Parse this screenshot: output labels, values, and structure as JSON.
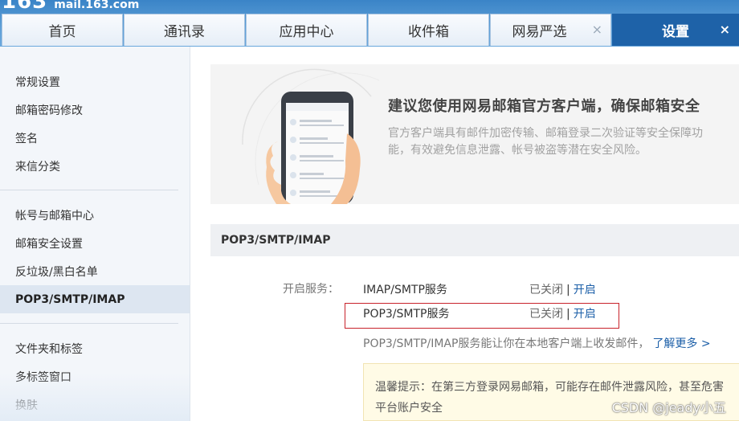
{
  "header": {
    "logo_number": "163",
    "logo_domain": "mail.163.com",
    "tabs": [
      {
        "label": "首页"
      },
      {
        "label": "通讯录"
      },
      {
        "label": "应用中心"
      },
      {
        "label": "收件箱"
      },
      {
        "label": "网易严选",
        "closable": true
      },
      {
        "label": "设置",
        "closable": true,
        "active": true
      }
    ],
    "close_glyph": "×"
  },
  "sidebar": {
    "groups": [
      {
        "items": [
          "常规设置",
          "邮箱密码修改",
          "签名",
          "来信分类"
        ]
      },
      {
        "items": [
          "帐号与邮箱中心",
          "邮箱安全设置",
          "反垃圾/黑白名单",
          "POP3/SMTP/IMAP"
        ]
      },
      {
        "items": [
          "文件夹和标签",
          "多标签窗口",
          "换肤"
        ]
      }
    ],
    "active_item": "POP3/SMTP/IMAP"
  },
  "banner": {
    "title": "建议您使用网易邮箱官方客户端，确保邮箱安全",
    "desc": "官方客户端具有邮件加密传输、邮箱登录二次验证等安全保障功能，有效避免信息泄露、帐号被盗等潜在安全风险。"
  },
  "section": {
    "title": "POP3/SMTP/IMAP",
    "service_label": "开启服务：",
    "services": [
      {
        "name": "IMAP/SMTP服务",
        "status": "已关闭",
        "action": "开启"
      },
      {
        "name": "POP3/SMTP服务",
        "status": "已关闭",
        "action": "开启",
        "highlighted": true
      }
    ],
    "separator": "|",
    "note": "POP3/SMTP/IMAP服务能让你在本地客户端上收发邮件，",
    "learn_more": "了解更多 >",
    "tip_line1": "温馨提示：在第三方登录网易邮箱，可能存在邮件泄露风险，甚至危害",
    "tip_line2": "平台账户安全"
  },
  "watermark": "CSDN @jeady小五",
  "colors": {
    "accent": "#1e62a8",
    "link": "#1c5fa8",
    "highlight_border": "#c8232b"
  }
}
